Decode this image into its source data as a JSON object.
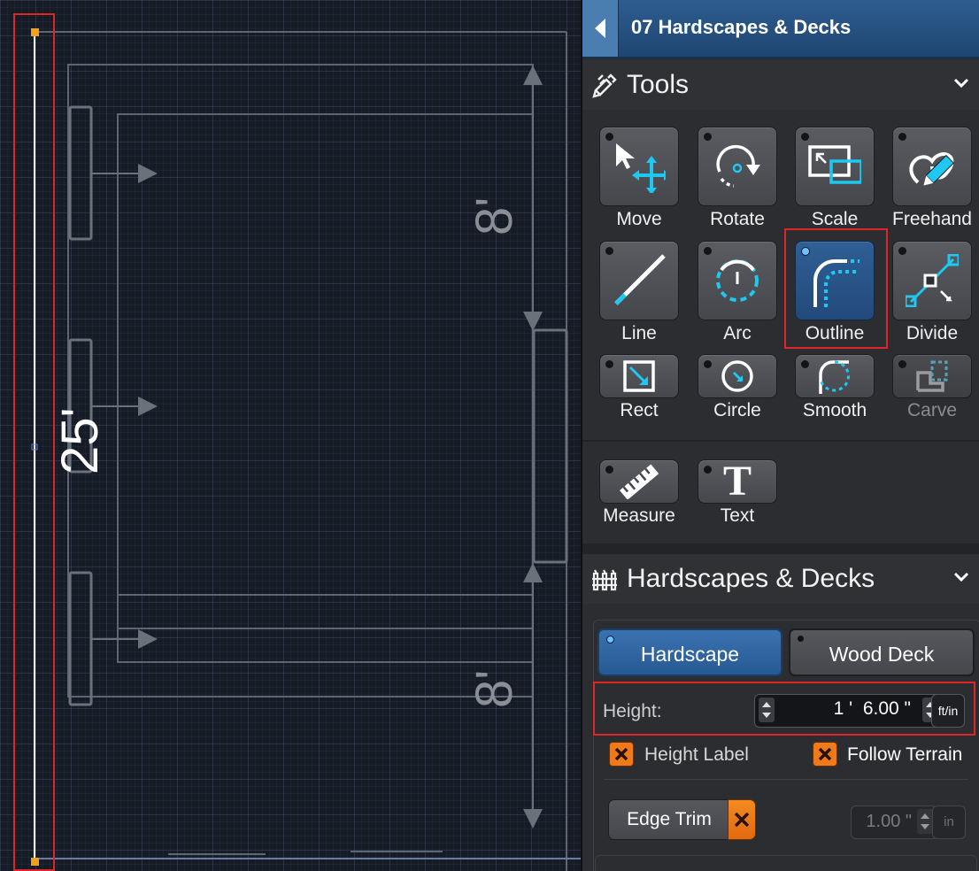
{
  "canvas": {
    "dimension_left": "25'",
    "dimension_right_top": "8'",
    "dimension_right_bottom": "8'"
  },
  "header": {
    "back_icon": "chevron-left-icon",
    "title": "07 Hardscapes & Decks"
  },
  "tools_section": {
    "title": "Tools",
    "icon": "pencil-ruler-icon",
    "collapse_icon": "chevron-down-icon",
    "tools": [
      {
        "label": "Move",
        "icon": "move-icon"
      },
      {
        "label": "Rotate",
        "icon": "rotate-icon"
      },
      {
        "label": "Scale",
        "icon": "scale-icon"
      },
      {
        "label": "Freehand",
        "icon": "freehand-icon"
      },
      {
        "label": "Line",
        "icon": "line-icon"
      },
      {
        "label": "Arc",
        "icon": "arc-icon"
      },
      {
        "label": "Outline",
        "icon": "outline-icon",
        "active": true
      },
      {
        "label": "Divide",
        "icon": "divide-icon"
      },
      {
        "label": "Rect",
        "icon": "rect-icon"
      },
      {
        "label": "Circle",
        "icon": "circle-icon"
      },
      {
        "label": "Smooth",
        "icon": "smooth-icon"
      },
      {
        "label": "Carve",
        "icon": "carve-icon",
        "disabled": true
      },
      {
        "label": "Measure",
        "icon": "ruler-icon"
      },
      {
        "label": "Text",
        "icon": "text-icon"
      }
    ]
  },
  "hardscapes_section": {
    "title": "Hardscapes & Decks",
    "icon": "fence-icon",
    "collapse_icon": "chevron-down-icon",
    "mode_buttons": {
      "hardscape": "Hardscape",
      "wood_deck": "Wood Deck",
      "selected": "Hardscape"
    },
    "height": {
      "label": "Height:",
      "value": "1 '  6.00 \"",
      "unit": "ft/in"
    },
    "height_label": {
      "label": "Height Label",
      "checked": false
    },
    "follow_terrain": {
      "label": "Follow Terrain",
      "checked": false
    },
    "edge_trim": {
      "label": "Edge Trim",
      "value": "1.00 \"",
      "unit": "in"
    }
  },
  "colors": {
    "accent_blue": "#2f5f95",
    "highlight_cyan": "#1ec8f0",
    "checkbox_orange": "#f07a1a",
    "annotation_red": "#e0242a"
  }
}
